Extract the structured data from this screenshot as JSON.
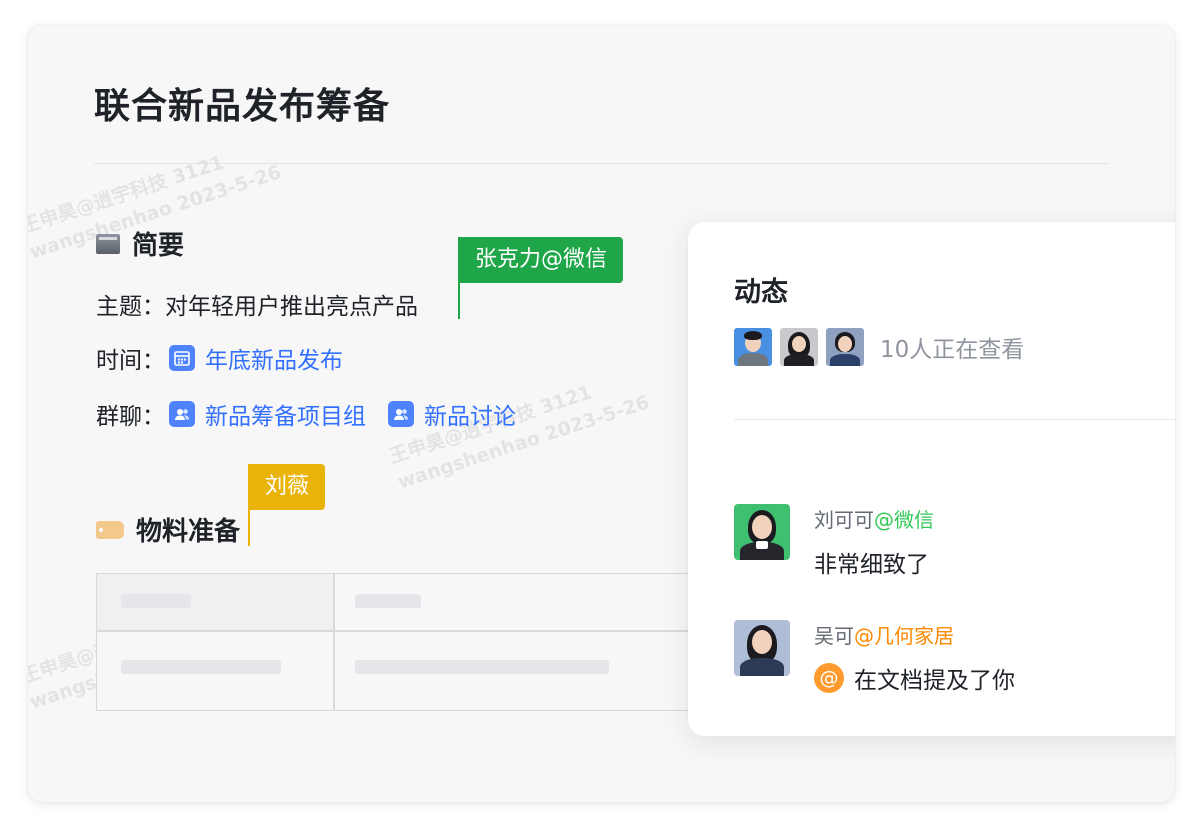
{
  "document": {
    "title": "联合新品发布筹备",
    "summary_heading": "简要",
    "topic_label": "主题：",
    "topic_value": "对年轻用户推出亮点产品",
    "time_label": "时间：",
    "time_link": "年底新品发布",
    "group_label": "群聊：",
    "group_links": [
      "新品筹备项目组",
      "新品讨论"
    ],
    "materials_heading": "物料准备"
  },
  "collaborators": [
    {
      "name": "张克力@微信",
      "color": "#1fa648"
    },
    {
      "name": "刘薇",
      "color": "#eab308"
    }
  ],
  "activity": {
    "title": "动态",
    "viewers_text": "10人正在查看",
    "messages": [
      {
        "name": "刘可可",
        "org": "@微信",
        "text": "非常细致了",
        "badge": ""
      },
      {
        "name": "吴可",
        "org": "@几何家居",
        "text": "在文档提及了你",
        "badge": "@"
      }
    ]
  },
  "watermark": {
    "line1": "王申昊@逍宇科技 3121",
    "line2": "wangshenhao 2023-5-26"
  },
  "icons": {
    "summary": "book-icon",
    "materials": "tag-icon",
    "calendar": "calendar-icon",
    "group": "group-chat-icon",
    "mention": "mention-icon"
  },
  "colors": {
    "link": "#3370ff",
    "green_cursor": "#1fa648",
    "yellow_cursor": "#eab308",
    "org_green": "#34c759",
    "org_orange": "#ff8800"
  }
}
